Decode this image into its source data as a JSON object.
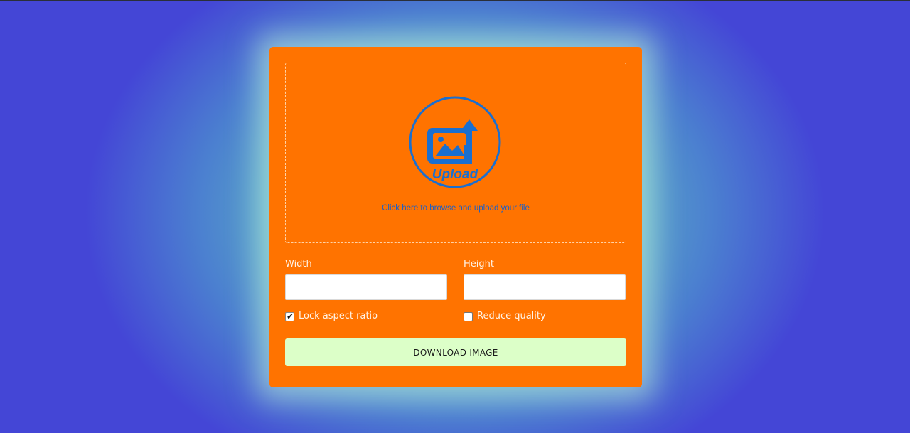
{
  "upload": {
    "icon_label": "Upload",
    "prompt": "Click here to browse and upload your file"
  },
  "width": {
    "label": "Width",
    "value": "",
    "placeholder": ""
  },
  "height": {
    "label": "Height",
    "value": "",
    "placeholder": ""
  },
  "options": {
    "lock_aspect_ratio": {
      "label": "Lock aspect ratio",
      "checked": true
    },
    "reduce_quality": {
      "label": "Reduce quality",
      "checked": false
    }
  },
  "download_button": {
    "label": "DOWNLOAD IMAGE"
  },
  "colors": {
    "card": "#ff7300",
    "button": "#dcffc8",
    "icon": "#1a6fd0"
  }
}
